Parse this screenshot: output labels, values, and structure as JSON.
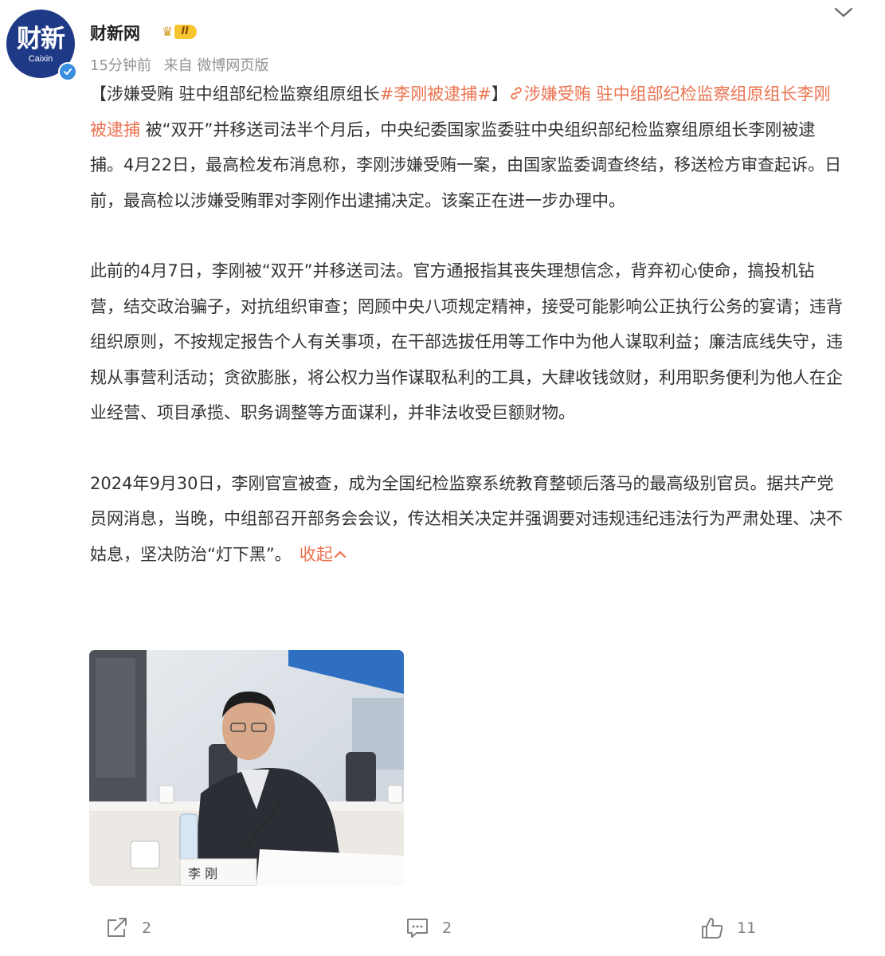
{
  "author": {
    "avatar_text": "财新",
    "avatar_subtext": "Caixin",
    "name": "财新网",
    "level": "II",
    "time": "15分钟前",
    "source": "来自 微博网页版"
  },
  "post": {
    "para1": {
      "bracket_open": "【涉嫌受贿 驻中组部纪检监察组原组长",
      "hashtag": "#李刚被逮捕#",
      "bracket_close": "】",
      "link_text": "涉嫌受贿 驻中组部纪检监察组原组长李刚被逮捕",
      "body": " 被“双开”并移送司法半个月后，中央纪委国家监委驻中央组织部纪检监察组原组长李刚被逮捕。4月22日，最高检发布消息称，李刚涉嫌受贿一案，由国家监委调查终结，移送检方审查起诉。日前，最高检以涉嫌受贿罪对李刚作出逮捕决定。该案正在进一步办理中。"
    },
    "para2": "此前的4月7日，李刚被“双开”并移送司法。官方通报指其丧失理想信念，背弃初心使命，搞投机钻营，结交政治骗子，对抗组织审查；罔顾中央八项规定精神，接受可能影响公正执行公务的宴请；违背组织原则，不按规定报告个人有关事项，在干部选拔任用等工作中为他人谋取利益；廉洁底线失守，违规从事营利活动；贪欲膨胀，将公权力当作谋取私利的工具，大肆收钱敛财，利用职务便利为他人在企业经营、项目承揽、职务调整等方面谋利，并非法收受巨额财物。",
    "para3": "2024年9月30日，李刚官宣被查，成为全国纪检监察系统教育整顿后落马的最高级别官员。据共产党员网消息，当晚，中组部召开部务会会议，传达相关决定并强调要对违规违纪违法行为严肃处理、决不姑息，坚决防治“灯下黑”。",
    "collapse_label": "收起",
    "photo_nameplate": "李 刚"
  },
  "actions": {
    "share_count": "2",
    "comment_count": "2",
    "like_count": "11"
  },
  "colors": {
    "accent": "#eb7350",
    "avatar_bg": "#1e3a86",
    "verified": "#3a8fe0"
  }
}
